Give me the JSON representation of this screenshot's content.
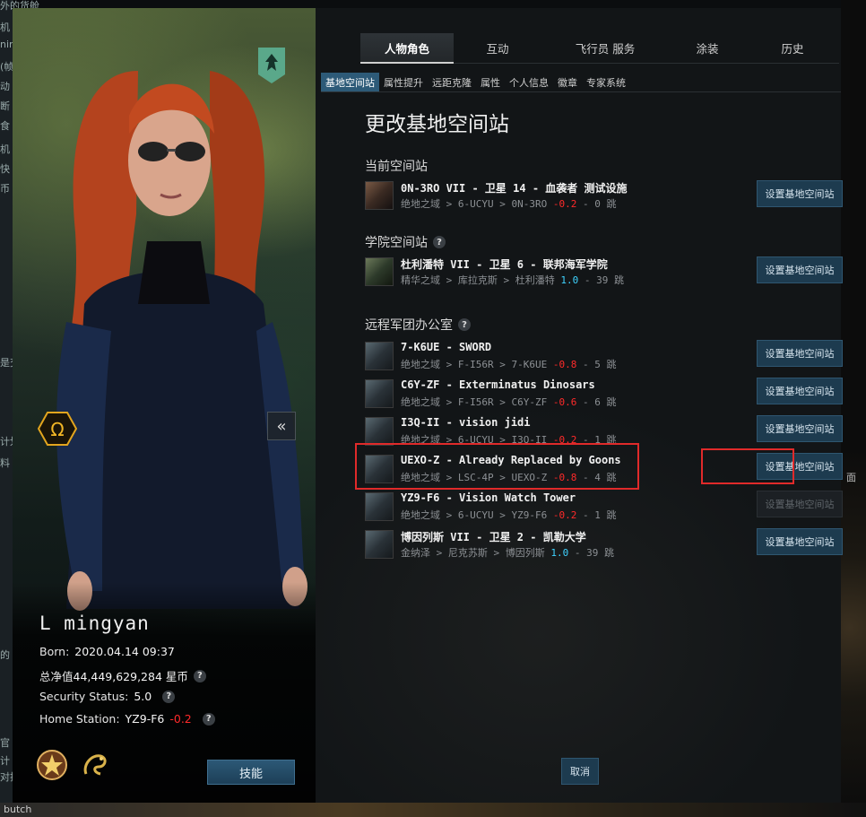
{
  "background": {
    "left_fragments": [
      "外的货舱",
      "机",
      "nin",
      "(帧",
      "动",
      "断",
      "食",
      "机",
      "快",
      "币",
      "是交",
      "计划",
      "料",
      "的",
      "官",
      "计",
      "对择"
    ],
    "right_fragments": [
      "面"
    ],
    "bottom_fragment": "butch"
  },
  "character": {
    "name": "L mingyan",
    "born_label": "Born:",
    "born_value": "2020.04.14 09:37",
    "networth_label": "总净值",
    "networth_value": "44,449,629,284 星币",
    "security_label": "Security Status:",
    "security_value": "5.0",
    "home_label": "Home Station:",
    "home_value": "YZ9-F6",
    "home_sec": "-0.2",
    "help": "?",
    "collapse_glyph": "«",
    "skills_label": "技能"
  },
  "main_tabs": [
    "人物角色",
    "互动",
    "飞行员 服务",
    "涂装",
    "历史"
  ],
  "sub_tabs": [
    "基地空间站",
    "属性提升",
    "远距克隆",
    "属性",
    "个人信息",
    "徽章",
    "专家系统"
  ],
  "page_title": "更改基地空间站",
  "sections": {
    "current": "当前空间站",
    "school": "学院空间站",
    "remote": "远程军团办公室"
  },
  "stations": {
    "current": [
      {
        "name": "0N-3RO VII - 卫星 14 - 血袭者 测试设施",
        "region": "绝地之域",
        "constellation": "6-UCYU",
        "system": "0N-3RO",
        "sec": "-0.2",
        "jumps": "0 跳"
      }
    ],
    "school": [
      {
        "name": "杜利潘特 VII - 卫星 6 - 联邦海军学院",
        "region": "精华之域",
        "constellation": "库拉克斯",
        "system": "杜利潘特",
        "sec": "1.0",
        "jumps": "39 跳"
      }
    ],
    "remote": [
      {
        "name": "7-K6UE - SWORD",
        "region": "绝地之域",
        "constellation": "F-I56R",
        "system": "7-K6UE",
        "sec": "-0.8",
        "jumps": "5 跳"
      },
      {
        "name": "C6Y-ZF - Exterminatus Dinosars",
        "region": "绝地之域",
        "constellation": "F-I56R",
        "system": "C6Y-ZF",
        "sec": "-0.6",
        "jumps": "6 跳"
      },
      {
        "name": "I3Q-II - vision jidi",
        "region": "绝地之域",
        "constellation": "6-UCYU",
        "system": "I3Q-II",
        "sec": "-0.2",
        "jumps": "1 跳"
      },
      {
        "name": "UEXO-Z - Already Replaced by Goons",
        "region": "绝地之域",
        "constellation": "LSC-4P",
        "system": "UEXO-Z",
        "sec": "-0.8",
        "jumps": "4 跳"
      },
      {
        "name": "YZ9-F6 - Vision Watch Tower",
        "region": "绝地之域",
        "constellation": "6-UCYU",
        "system": "YZ9-F6",
        "sec": "-0.2",
        "jumps": "1 跳"
      },
      {
        "name": "博因列斯 VII - 卫星 2 - 凯勒大学",
        "region": "金纳泽",
        "constellation": "尼克苏斯",
        "system": "博因列斯",
        "sec": "1.0",
        "jumps": "39 跳"
      }
    ]
  },
  "set_button_label": "设置基地空间站",
  "route_sep": ">",
  "cancel_label": "取消",
  "colors": {
    "accent": "#2d5a78",
    "negative_sec": "#ff2a2a",
    "positive_sec": "#3fd3ff",
    "highlight": "#e02a2a"
  }
}
